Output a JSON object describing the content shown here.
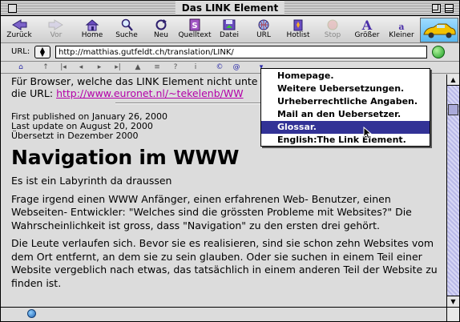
{
  "window": {
    "title": "Das LINK Element"
  },
  "toolbar": {
    "buttons": [
      {
        "label": "Zurück",
        "icon": "back-arrow-icon",
        "enabled": true
      },
      {
        "label": "Vor",
        "icon": "forward-arrow-icon",
        "enabled": false
      },
      {
        "label": "Home",
        "icon": "home-icon",
        "enabled": true
      },
      {
        "label": "Suche",
        "icon": "magnifier-icon",
        "enabled": true
      },
      {
        "label": "Neu",
        "icon": "reload-icon",
        "enabled": true
      },
      {
        "label": "Quelltext",
        "icon": "source-icon",
        "enabled": true
      },
      {
        "label": "Datei",
        "icon": "save-file-icon",
        "enabled": true
      },
      {
        "label": "URL",
        "icon": "globe-icon",
        "enabled": true
      },
      {
        "label": "Hotlist",
        "icon": "hotlist-icon",
        "enabled": true
      },
      {
        "label": "Stop",
        "icon": "stop-icon",
        "enabled": false
      },
      {
        "label": "Größer",
        "icon": "font-bigger-icon",
        "enabled": true
      },
      {
        "label": "Kleiner",
        "icon": "font-smaller-icon",
        "enabled": true
      }
    ],
    "logo": "car-logo-icon"
  },
  "location": {
    "label": "URL:",
    "url": "http://matthias.gutfeldt.ch/translation/LINK/"
  },
  "content": {
    "intro_text": "Für Browser, welche das LINK Element nicht unte",
    "intro_prefix": "die URL: ",
    "intro_url": "http://www.euronet.nl/~tekelenb/WW",
    "meta_lines": [
      "First published on January 26, 2000",
      "Last update on August 20, 2000",
      "Übersetzt in Dezember 2000"
    ],
    "heading": "Navigation im WWW",
    "paragraphs": [
      "Es ist ein Labyrinth da draussen",
      "Frage irgend einen WWW Anfänger, einen erfahrenen Web- Benutzer, einen Webseiten- Entwickler: \"Welches sind die grössten Probleme mit Websites?\" Die Wahrscheinlichkeit ist gross, dass \"Navigation\" zu den ersten drei gehört.",
      "Die Leute verlaufen sich. Bevor sie es realisieren, sind sie schon zehn Websites vom dem Ort entfernt, an dem sie zu sein glauben. Oder sie suchen in einem Teil einer Website vergeblich nach etwas, das tatsächlich in einem anderen Teil der Website zu finden ist."
    ]
  },
  "popup_menu": {
    "items": [
      {
        "label": "Homepage.",
        "selected": false
      },
      {
        "label": "Weitere Uebersetzungen.",
        "selected": false
      },
      {
        "label": "Urheberrechtliche Angaben.",
        "selected": false
      },
      {
        "label": "Mail an den Uebersetzer.",
        "selected": false
      },
      {
        "label": "Glossar.",
        "selected": true
      },
      {
        "label": "English:The Link Element.",
        "selected": false
      }
    ]
  },
  "colors": {
    "link": "#b400a9",
    "menu_highlight": "#323296",
    "scrollbar": "#c8c8f0"
  }
}
